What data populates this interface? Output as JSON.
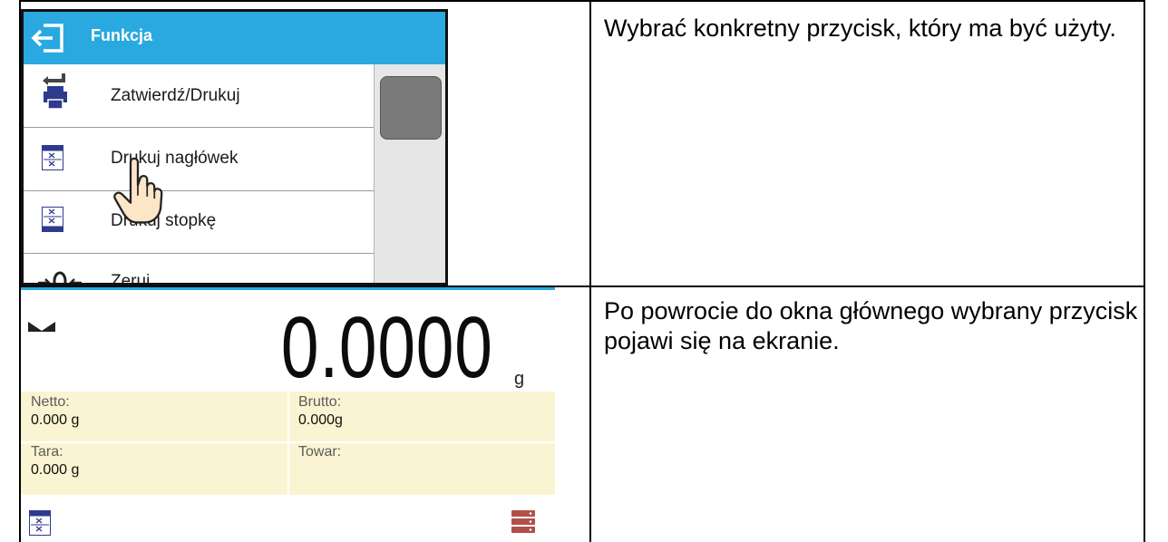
{
  "step1": {
    "header": {
      "title": "Funkcja"
    },
    "items": [
      {
        "label": "Zatwierdź/Drukuj",
        "icon": "confirm-print-icon"
      },
      {
        "label": "Drukuj nagłówek",
        "icon": "print-header-icon"
      },
      {
        "label": "Drukuj stopkę",
        "icon": "print-footer-icon"
      },
      {
        "label": "Zeruj",
        "icon": "zero-icon"
      }
    ],
    "description": "Wybrać konkretny przycisk, który ma być użyty."
  },
  "step2": {
    "weight": "0.0000",
    "unit": "g",
    "fields": {
      "netto": {
        "label": "Netto:",
        "value": "0.000 g"
      },
      "brutto": {
        "label": "Brutto:",
        "value": "0.000g"
      },
      "tara": {
        "label": "Tara:",
        "value": "0.000 g"
      },
      "towar": {
        "label": "Towar:",
        "value": ""
      }
    },
    "description": "Po powrocie do okna głównego wybrany przycisk pojawi się na ekranie."
  },
  "colors": {
    "accent": "#2aa9e1",
    "icon_blue": "#2e3a8c",
    "info_bg": "#fbf4d2",
    "scrollbar": "#e6e6e6"
  }
}
